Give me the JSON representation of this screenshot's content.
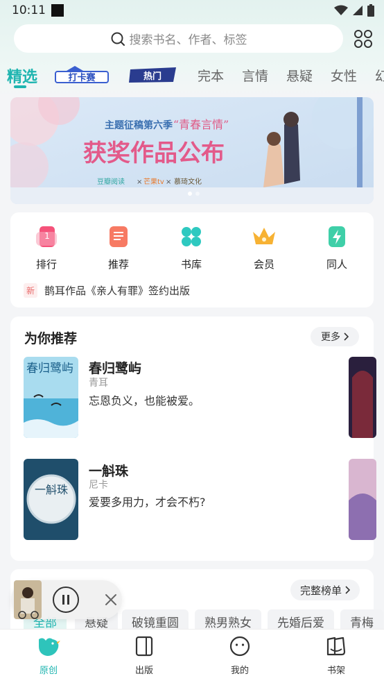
{
  "status_bar": {
    "time": "10:11"
  },
  "search": {
    "placeholder": "搜索书名、作者、标签"
  },
  "tabs": [
    {
      "label": "精选",
      "active": true
    },
    {
      "label": "打卡赛",
      "logo": true
    },
    {
      "label": "热门",
      "logo": true
    },
    {
      "label": "完本"
    },
    {
      "label": "言情"
    },
    {
      "label": "悬疑"
    },
    {
      "label": "女性"
    },
    {
      "label": "幻"
    }
  ],
  "banner": {
    "subtitle": "主题征稿第六季",
    "theme": "“青春言情”",
    "title": "获奖作品公布",
    "partners": [
      "豆瓣阅读",
      "芒果tv",
      "慕琦文化"
    ],
    "dots": 2
  },
  "entries": [
    {
      "label": "排行",
      "icon": "ranking-icon",
      "color": "#f5527a"
    },
    {
      "label": "推荐",
      "icon": "recommend-icon",
      "color": "#f77a63"
    },
    {
      "label": "书库",
      "icon": "library-icon",
      "color": "#2ec9c0"
    },
    {
      "label": "会员",
      "icon": "crown-icon",
      "color": "#f7b233"
    },
    {
      "label": "同人",
      "icon": "lightning-icon",
      "color": "#3fcfa8"
    }
  ],
  "news": {
    "badge": "新",
    "text": "鹊耳作品《亲人有罪》签约出版"
  },
  "recommend": {
    "title": "为你推荐",
    "more": "更多",
    "books": [
      {
        "title": "春归鹭屿",
        "author": "青耳",
        "desc": "忘恩负义，也能被爱。",
        "cover_text": "春归鹭屿"
      },
      {
        "title": "一斛珠",
        "author": "尼卡",
        "desc": "爱要多用力，才会不朽?",
        "cover_text": "一斛珠"
      }
    ]
  },
  "ranking": {
    "full_button": "完整榜单",
    "chips": [
      "全部",
      "悬疑",
      "破镜重圆",
      "熟男熟女",
      "先婚后爱",
      "青梅"
    ]
  },
  "bottom_nav": [
    {
      "label": "原创",
      "icon": "bird-icon",
      "active": true
    },
    {
      "label": "出版",
      "icon": "book-icon"
    },
    {
      "label": "我的",
      "icon": "profile-icon"
    },
    {
      "label": "书架",
      "icon": "bookshelf-icon"
    }
  ],
  "colors": {
    "accent": "#1fb5b0"
  }
}
